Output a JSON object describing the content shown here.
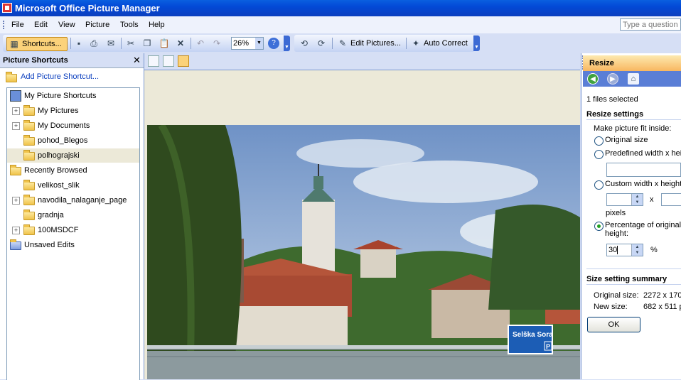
{
  "app": {
    "title": "Microsoft Office Picture Manager"
  },
  "menu": {
    "items": [
      "File",
      "Edit",
      "View",
      "Picture",
      "Tools",
      "Help"
    ],
    "help_placeholder": "Type a question f"
  },
  "toolbar": {
    "shortcuts_label": "Shortcuts...",
    "zoom_value": "26%",
    "edit_pictures_label": "Edit Pictures...",
    "auto_correct_label": "Auto Correct"
  },
  "left_pane": {
    "title": "Picture Shortcuts",
    "add_shortcut": "Add Picture Shortcut...",
    "tree": {
      "my_picture_shortcuts": "My Picture Shortcuts",
      "my_pictures": "My Pictures",
      "my_documents": "My Documents",
      "pohod_blegos": "pohod_Blegos",
      "polhograjski": "polhograjski",
      "recently_browsed": "Recently Browsed",
      "velikost_slik": "velikost_slik",
      "navodila": "navodila_nalaganje_page",
      "gradnja": "gradnja",
      "msdcf": "100MSDCF",
      "unsaved_edits": "Unsaved Edits"
    }
  },
  "photo": {
    "sign_text": "Selška Sora",
    "sign_p": "P"
  },
  "resize_pane": {
    "title": "Resize",
    "files_selected": "1 files selected",
    "settings_heading": "Resize settings",
    "fit_label": "Make picture fit inside:",
    "opt_original": "Original size",
    "opt_predefined": "Predefined width x heig",
    "opt_custom": "Custom width x height",
    "x_label": "x",
    "pixels_label": "pixels",
    "opt_percentage_line1": "Percentage of original",
    "opt_percentage_line2": "height:",
    "percentage_value": "30",
    "percent_sign": "%",
    "summary_heading": "Size setting summary",
    "original_size_label": "Original size:",
    "original_size_value": "2272 x 170",
    "new_size_label": "New size:",
    "new_size_value": "682 x 511 p",
    "ok_label": "OK"
  },
  "colors": {
    "titlebar": "#0349d6",
    "resize_header": "#f8b760",
    "selection": "#ece9d8"
  }
}
